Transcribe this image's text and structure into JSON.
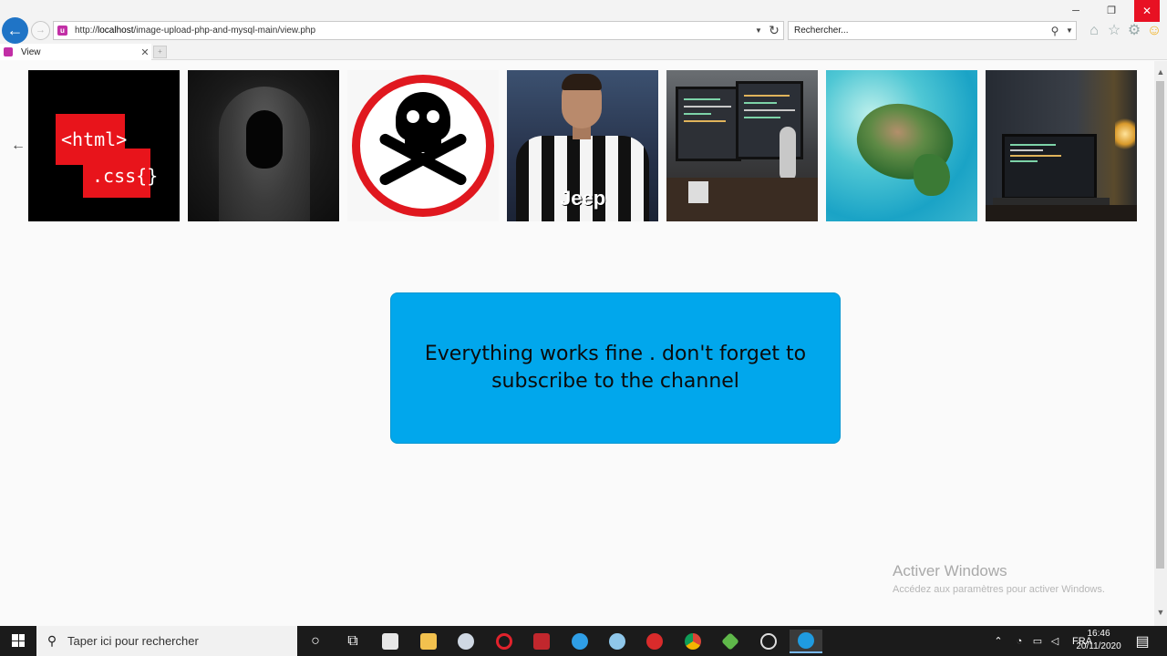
{
  "browser": {
    "url_prefix": "http://",
    "url_host": "localhost",
    "url_path": "/image-upload-php-and-mysql-main/view.php",
    "search_placeholder": "Rechercher...",
    "tab_title": "View"
  },
  "page": {
    "back_arrow": "←",
    "gallery": [
      {
        "name": "html-css-image",
        "text_line1": "<html>",
        "text_line2": ".css{}"
      },
      {
        "name": "hooded-figure-image"
      },
      {
        "name": "skull-sign-image"
      },
      {
        "name": "footballer-image",
        "sponsor": "Jeep"
      },
      {
        "name": "desk-setup-image"
      },
      {
        "name": "island-image"
      },
      {
        "name": "laptop-image"
      }
    ],
    "message": "Everything works fine . don't forget to subscribe to the channel",
    "message_bg": "#01a7ec"
  },
  "watermark": {
    "title": "Activer Windows",
    "subtitle": "Accédez aux paramètres pour activer Windows."
  },
  "taskbar": {
    "search_placeholder": "Taper ici pour rechercher",
    "language": "FRA",
    "time": "16:46",
    "date": "20/11/2020",
    "apps": [
      "cortana-icon",
      "task-view-icon",
      "store-icon",
      "file-explorer-icon",
      "app-icon",
      "opera-icon",
      "filezilla-icon",
      "edge-icon",
      "onedrive-icon",
      "app-icon-2",
      "chrome-icon",
      "app-icon-3",
      "app-icon-4",
      "internet-explorer-icon"
    ]
  },
  "colors": {
    "close_button": "#e81123",
    "accent": "#1f74c6"
  }
}
